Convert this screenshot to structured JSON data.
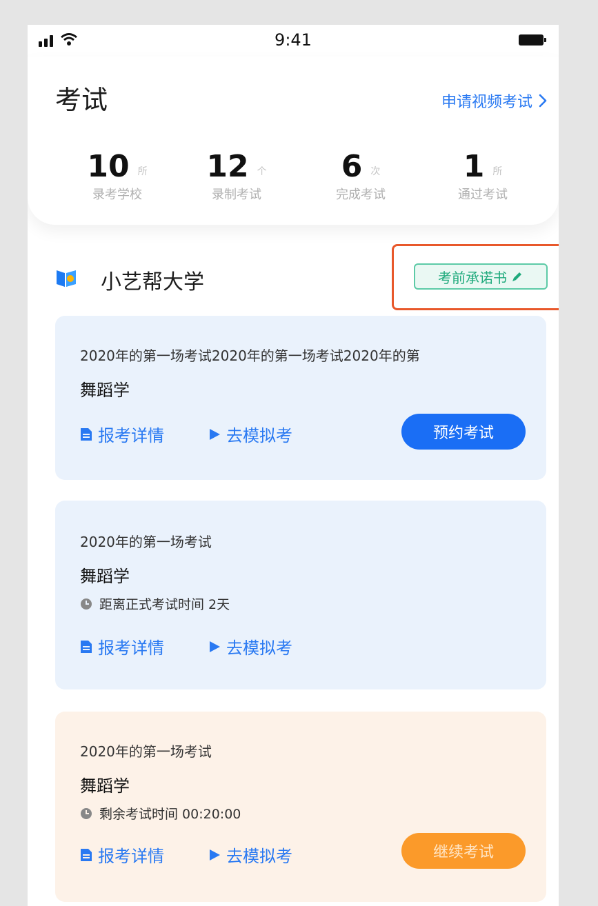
{
  "status_bar": {
    "time": "9:41"
  },
  "header": {
    "title": "考试",
    "apply_video_exam": "申请视频考试"
  },
  "stats": [
    {
      "value": "10",
      "unit": "所",
      "label": "录考学校"
    },
    {
      "value": "12",
      "unit": "个",
      "label": "录制考试"
    },
    {
      "value": "6",
      "unit": "次",
      "label": "完成考试"
    },
    {
      "value": "1",
      "unit": "所",
      "label": "通过考试"
    }
  ],
  "school": {
    "name": "小艺帮大学",
    "pledge_button": "考前承诺书"
  },
  "exams": [
    {
      "title": "2020年的第一场考试2020年的第一场考试2020年的第",
      "subject": "舞蹈学",
      "details_link": "报考详情",
      "mock_link": "去模拟考",
      "action_button": "预约考试"
    },
    {
      "title": "2020年的第一场考试",
      "subject": "舞蹈学",
      "countdown": "距离正式考试时间 2天",
      "details_link": "报考详情",
      "mock_link": "去模拟考"
    },
    {
      "title": "2020年的第一场考试",
      "subject": "舞蹈学",
      "countdown": "剩余考试时间 00:20:00",
      "details_link": "报考详情",
      "mock_link": "去模拟考",
      "action_button": "继续考试"
    }
  ],
  "colors": {
    "accent_blue": "#2979f2",
    "button_blue": "#1a6ef5",
    "button_orange": "#fb9a2a",
    "pledge_green": "#1faa7c",
    "highlight_red": "#e8582b"
  }
}
